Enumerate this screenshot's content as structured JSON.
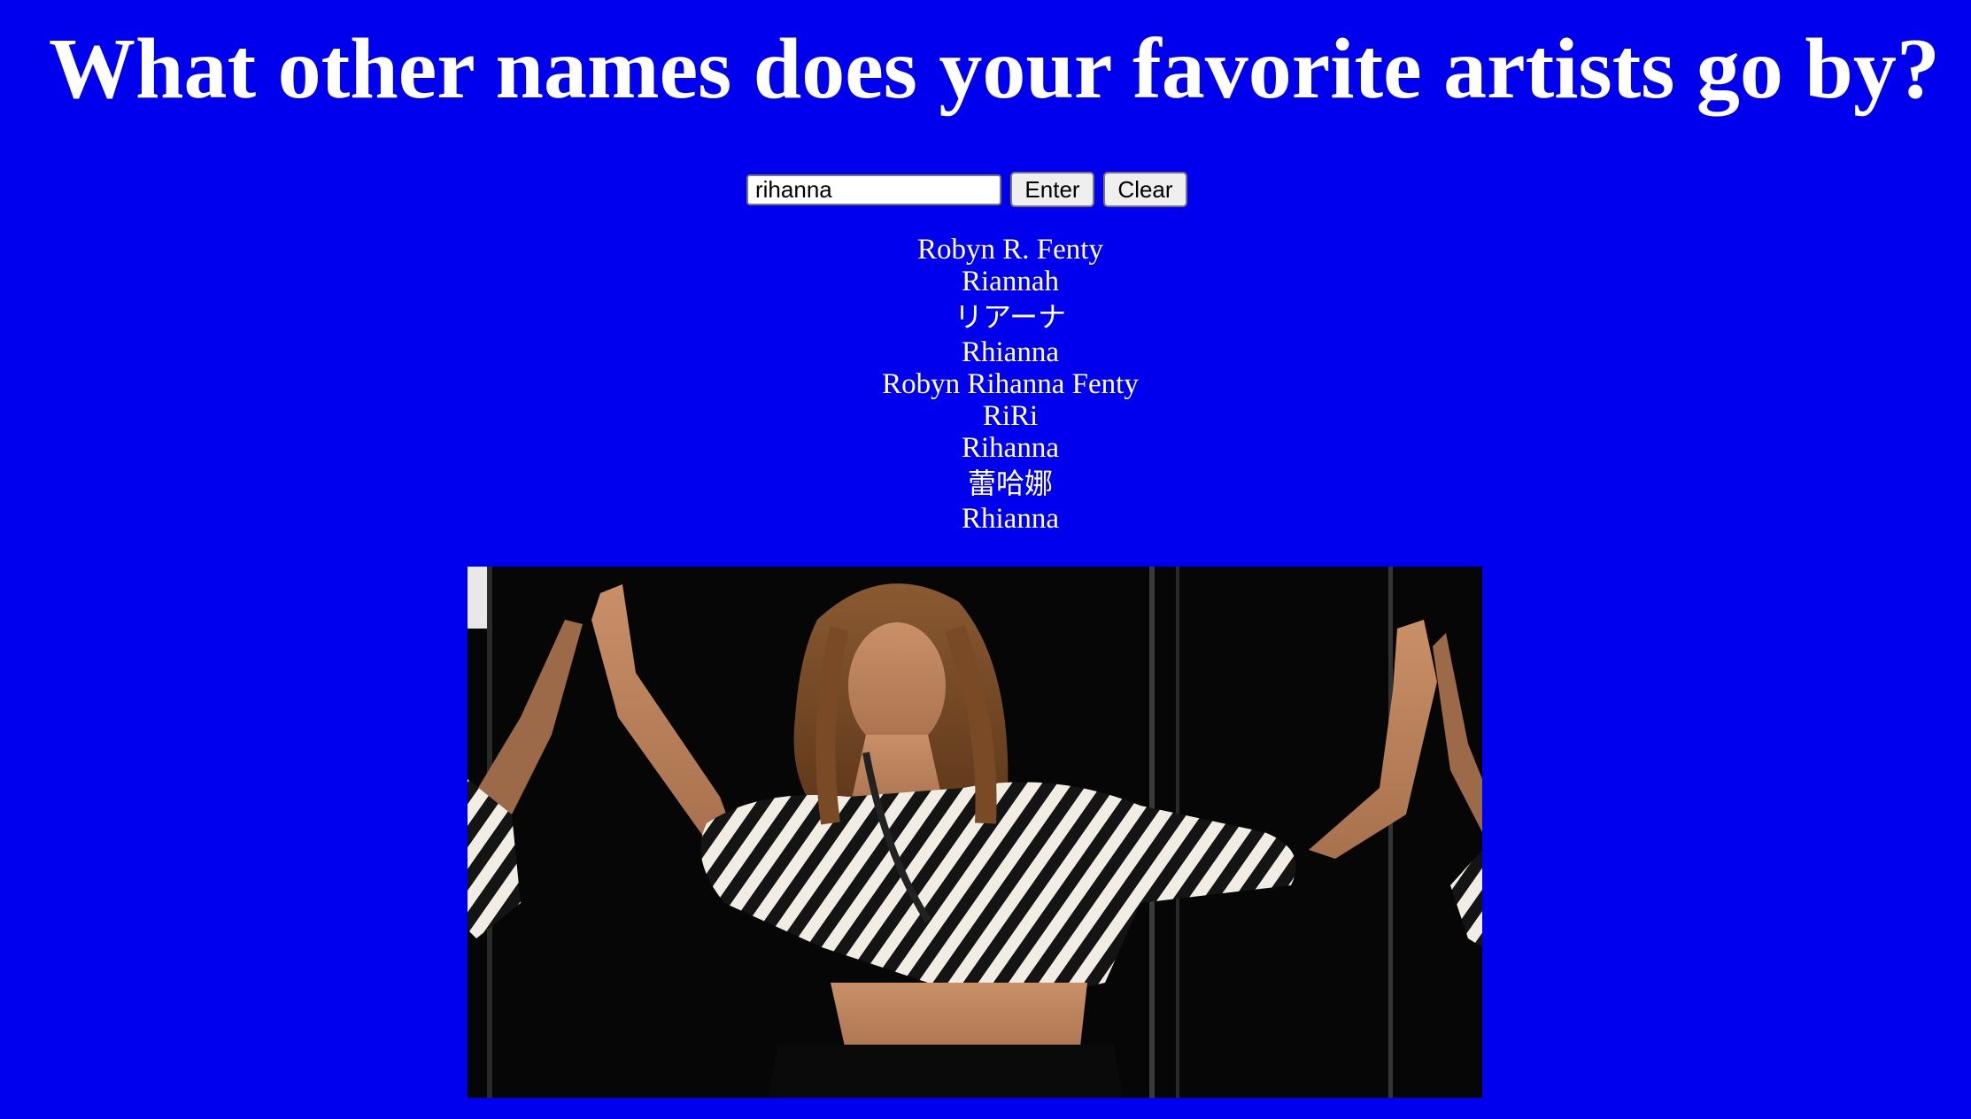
{
  "header": {
    "title": "What other names does your favorite artists go by?"
  },
  "search": {
    "value": "rihanna",
    "placeholder": "",
    "enter_label": "Enter",
    "clear_label": "Clear"
  },
  "aliases": [
    "Robyn R. Fenty",
    "Riannah",
    "リアーナ",
    "Rhianna",
    "Robyn Rihanna Fenty",
    "RiRi",
    "Rihanna",
    "蕾哈娜",
    "Rhianna"
  ],
  "photo": {
    "subject": "Artist photo: woman in black-and-white striped crop top posing with arms raised against mirrors on a black background"
  },
  "colors": {
    "background": "#0000ee",
    "text": "#ffffff",
    "button_bg": "#efefef"
  }
}
